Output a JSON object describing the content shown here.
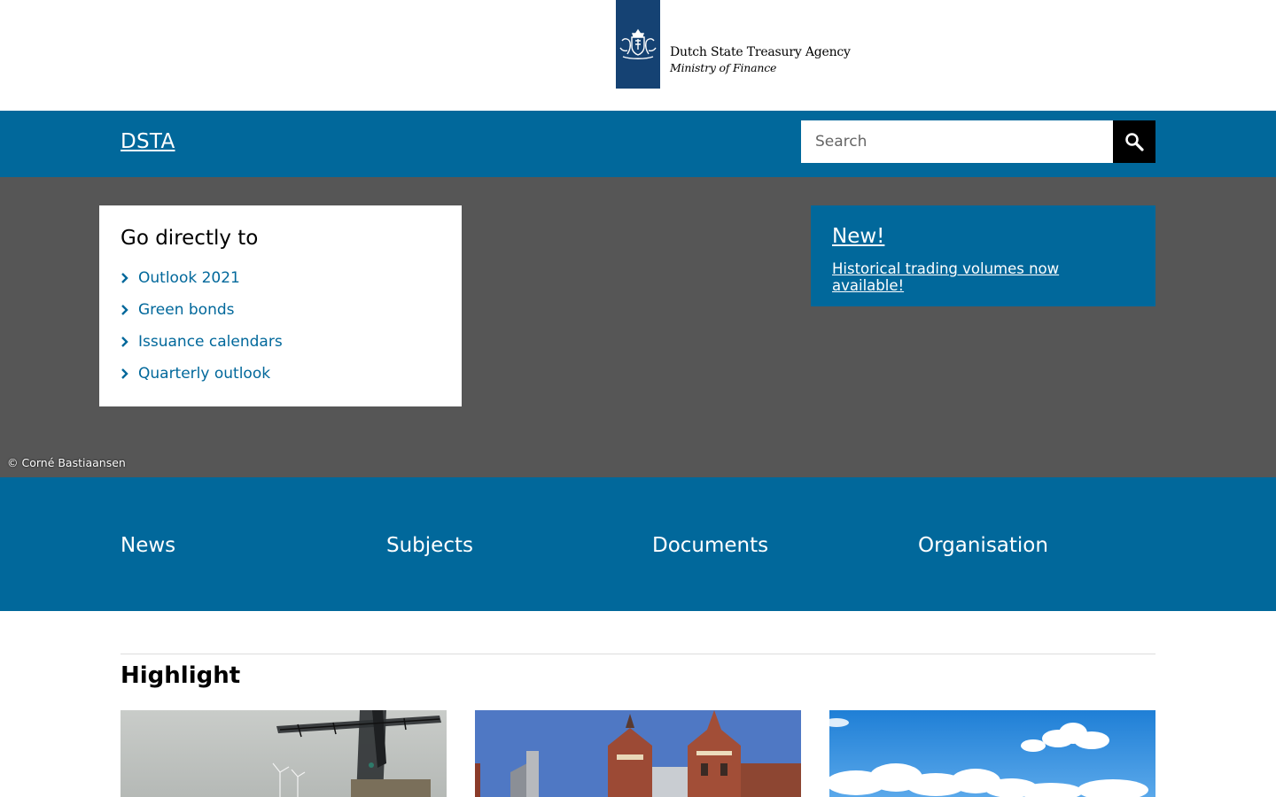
{
  "header": {
    "logo_line1": "Dutch State Treasury Agency",
    "logo_line2": "Ministry of Finance"
  },
  "bar": {
    "brand": "DSTA",
    "search_placeholder": "Search"
  },
  "hero": {
    "goto_title": "Go directly to",
    "goto_links": [
      "Outlook 2021",
      "Green bonds",
      "Issuance calendars",
      "Quarterly outlook"
    ],
    "new_title": "New!",
    "new_link": "Historical trading volumes now available!",
    "credit": "© Corné Bastiaansen"
  },
  "nav": {
    "items": [
      "News",
      "Subjects",
      "Documents",
      "Organisation"
    ]
  },
  "highlight": {
    "title": "Highlight"
  },
  "colors": {
    "brand_blue": "#01689b",
    "logo_blue": "#154273",
    "hero_gray": "#565656"
  }
}
